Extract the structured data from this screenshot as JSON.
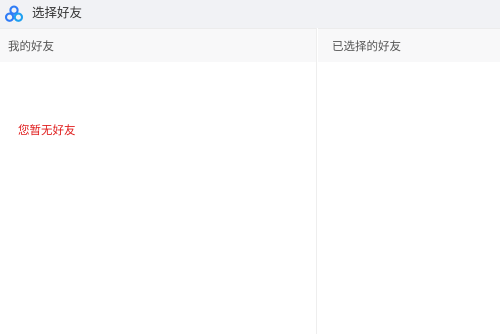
{
  "window": {
    "title": "选择好友",
    "logo_icon": "cloud-rings-icon",
    "accent_color": "#2f7cf6"
  },
  "left_panel": {
    "header": "我的好友",
    "empty_message": "您暂无好友"
  },
  "right_panel": {
    "header": "已选择的好友"
  }
}
